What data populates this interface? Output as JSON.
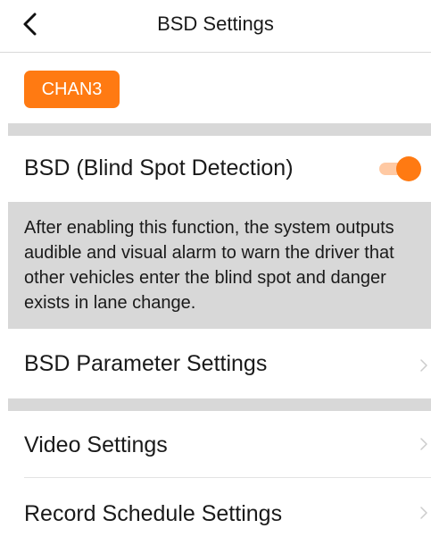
{
  "header": {
    "title": "BSD Settings",
    "back_icon": "chevron-left-icon"
  },
  "channel": {
    "label": "CHAN3",
    "color": "#ff7a12"
  },
  "bsd": {
    "label": "BSD (Blind Spot Detection)",
    "enabled": true,
    "toggle_color": "#ff7a12",
    "description": "After enabling this function, the system outputs audible and visual alarm to warn the driver that other vehicles enter the blind spot and danger exists in lane change."
  },
  "menu": {
    "parameter_settings": "BSD Parameter Settings",
    "video_settings": "Video Settings",
    "record_schedule_settings": "Record Schedule Settings",
    "item_icon": "chevron-right-icon"
  },
  "colors": {
    "accent": "#ff7a12",
    "section_gap": "#d8d8d8"
  }
}
